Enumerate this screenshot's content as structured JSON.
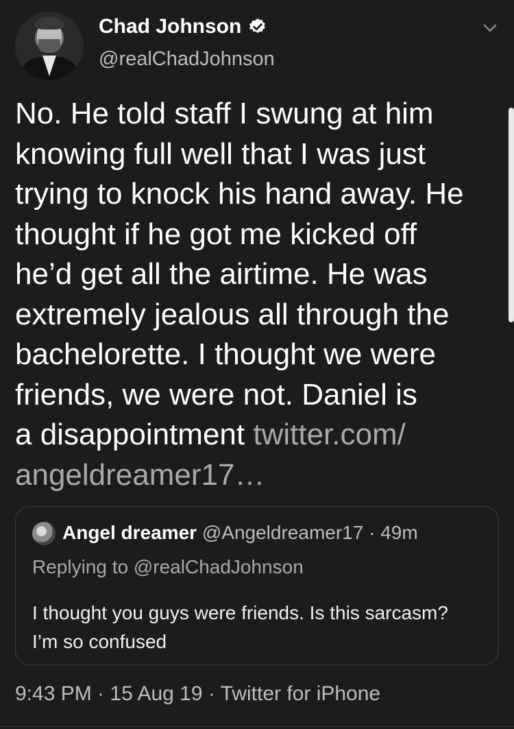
{
  "author": {
    "name": "Chad Johnson",
    "handle": "@realChadJohnson",
    "verified": true,
    "avatar_icon": "profile-photo"
  },
  "tweet": {
    "text": "No. He told staff I swung at him\nknowing full well that I was just\ntrying to knock his hand away. He\nthought if he got me kicked off\nhe’d get all the airtime. He was\nextremely jealous all through the\nbachelorette. I thought we were\nfriends, we were not. Daniel is\na disappointment ",
    "link_line1": "twitter.com/",
    "link_line2": "angeldreamer17…"
  },
  "quoted_tweet": {
    "name": "Angel dreamer",
    "handle": "@Angeldreamer17",
    "separator": " · ",
    "time": "49m",
    "replying_to": "Replying to @realChadJohnson",
    "text": "I thought you guys were friends. Is this sarcasm? I’m so confused"
  },
  "meta": {
    "time": "9:43 PM",
    "separator": " · ",
    "date": "15 Aug 19",
    "source": "Twitter for iPhone"
  },
  "colors": {
    "background": "#1c1c1c",
    "primary_text": "#ffffff",
    "secondary_text": "#bdbdbd",
    "link_text": "#a9a9a9"
  },
  "icons": {
    "verified": "verified-badge-icon",
    "menu": "chevron-down-icon"
  }
}
